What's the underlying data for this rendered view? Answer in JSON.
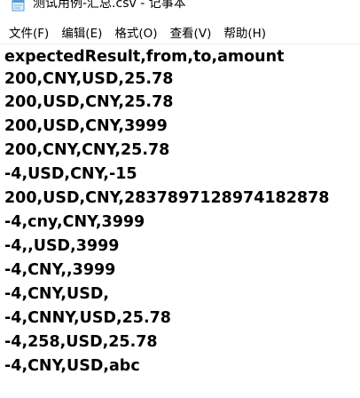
{
  "window": {
    "title": "测试用例-汇总.csv - 记事本",
    "icon": "notepad-icon"
  },
  "menu": [
    {
      "label": "文件(F)"
    },
    {
      "label": "编辑(E)"
    },
    {
      "label": "格式(O)"
    },
    {
      "label": "查看(V)"
    },
    {
      "label": "帮助(H)"
    }
  ],
  "content": {
    "lines": [
      "expectedResult,from,to,amount",
      "200,CNY,USD,25.78",
      "200,USD,CNY,25.78",
      "200,USD,CNY,3999",
      "200,CNY,CNY,25.78",
      "-4,USD,CNY,-15",
      "200,USD,CNY,2837897128974182878",
      "-4,cny,CNY,3999",
      "-4,,USD,3999",
      "-4,CNY,,3999",
      "-4,CNY,USD,",
      "-4,CNNY,USD,25.78",
      "-4,258,USD,25.78",
      "-4,CNY,USD,abc"
    ]
  }
}
